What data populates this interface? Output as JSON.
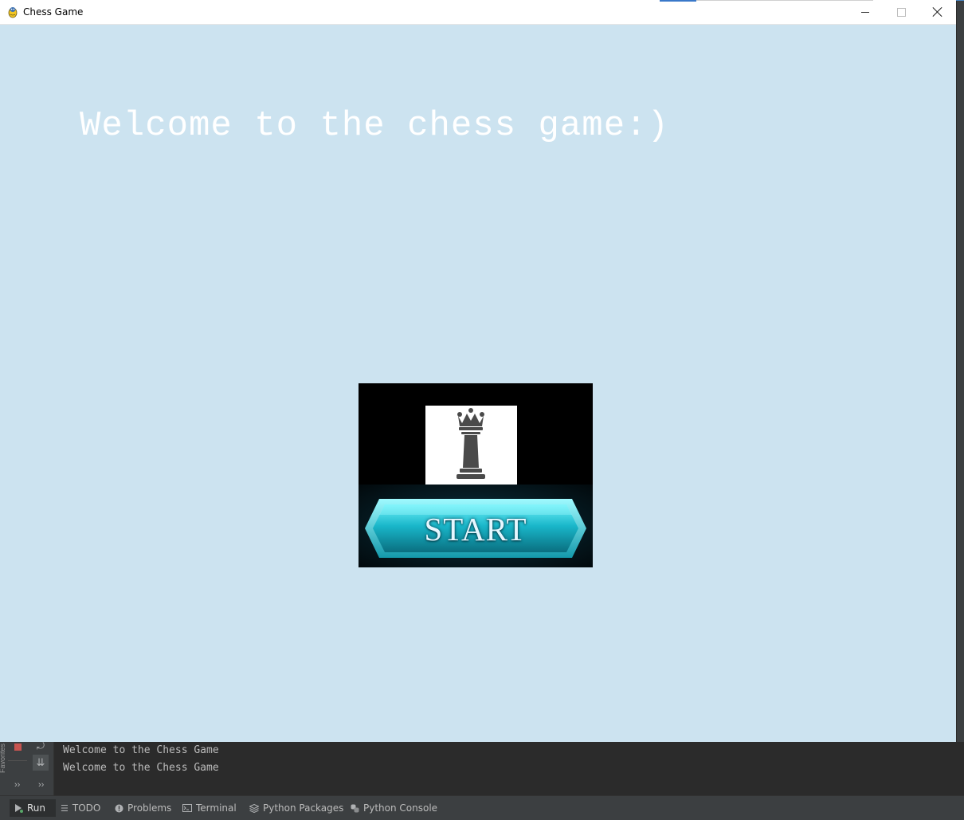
{
  "window": {
    "title": "Chess Game",
    "controls": {
      "minimize": "minimize",
      "maximize": "maximize",
      "close": "close"
    }
  },
  "game": {
    "welcome_text": "Welcome to the chess game:)",
    "start_label": "START",
    "colors": {
      "background": "#cce3f0",
      "start_glow": "#29d8e8"
    }
  },
  "ide": {
    "side_label": "Favorites",
    "console_lines": [
      "Welcome to the Chess Game",
      "Welcome to the Chess Game"
    ],
    "tool_windows": [
      {
        "label": "Run",
        "icon": "run-icon",
        "active": true
      },
      {
        "label": "TODO",
        "icon": "list-icon",
        "active": false
      },
      {
        "label": "Problems",
        "icon": "info-icon",
        "active": false
      },
      {
        "label": "Terminal",
        "icon": "terminal-icon",
        "active": false
      },
      {
        "label": "Python Packages",
        "icon": "layers-icon",
        "active": false
      },
      {
        "label": "Python Console",
        "icon": "python-icon",
        "active": false
      }
    ]
  }
}
